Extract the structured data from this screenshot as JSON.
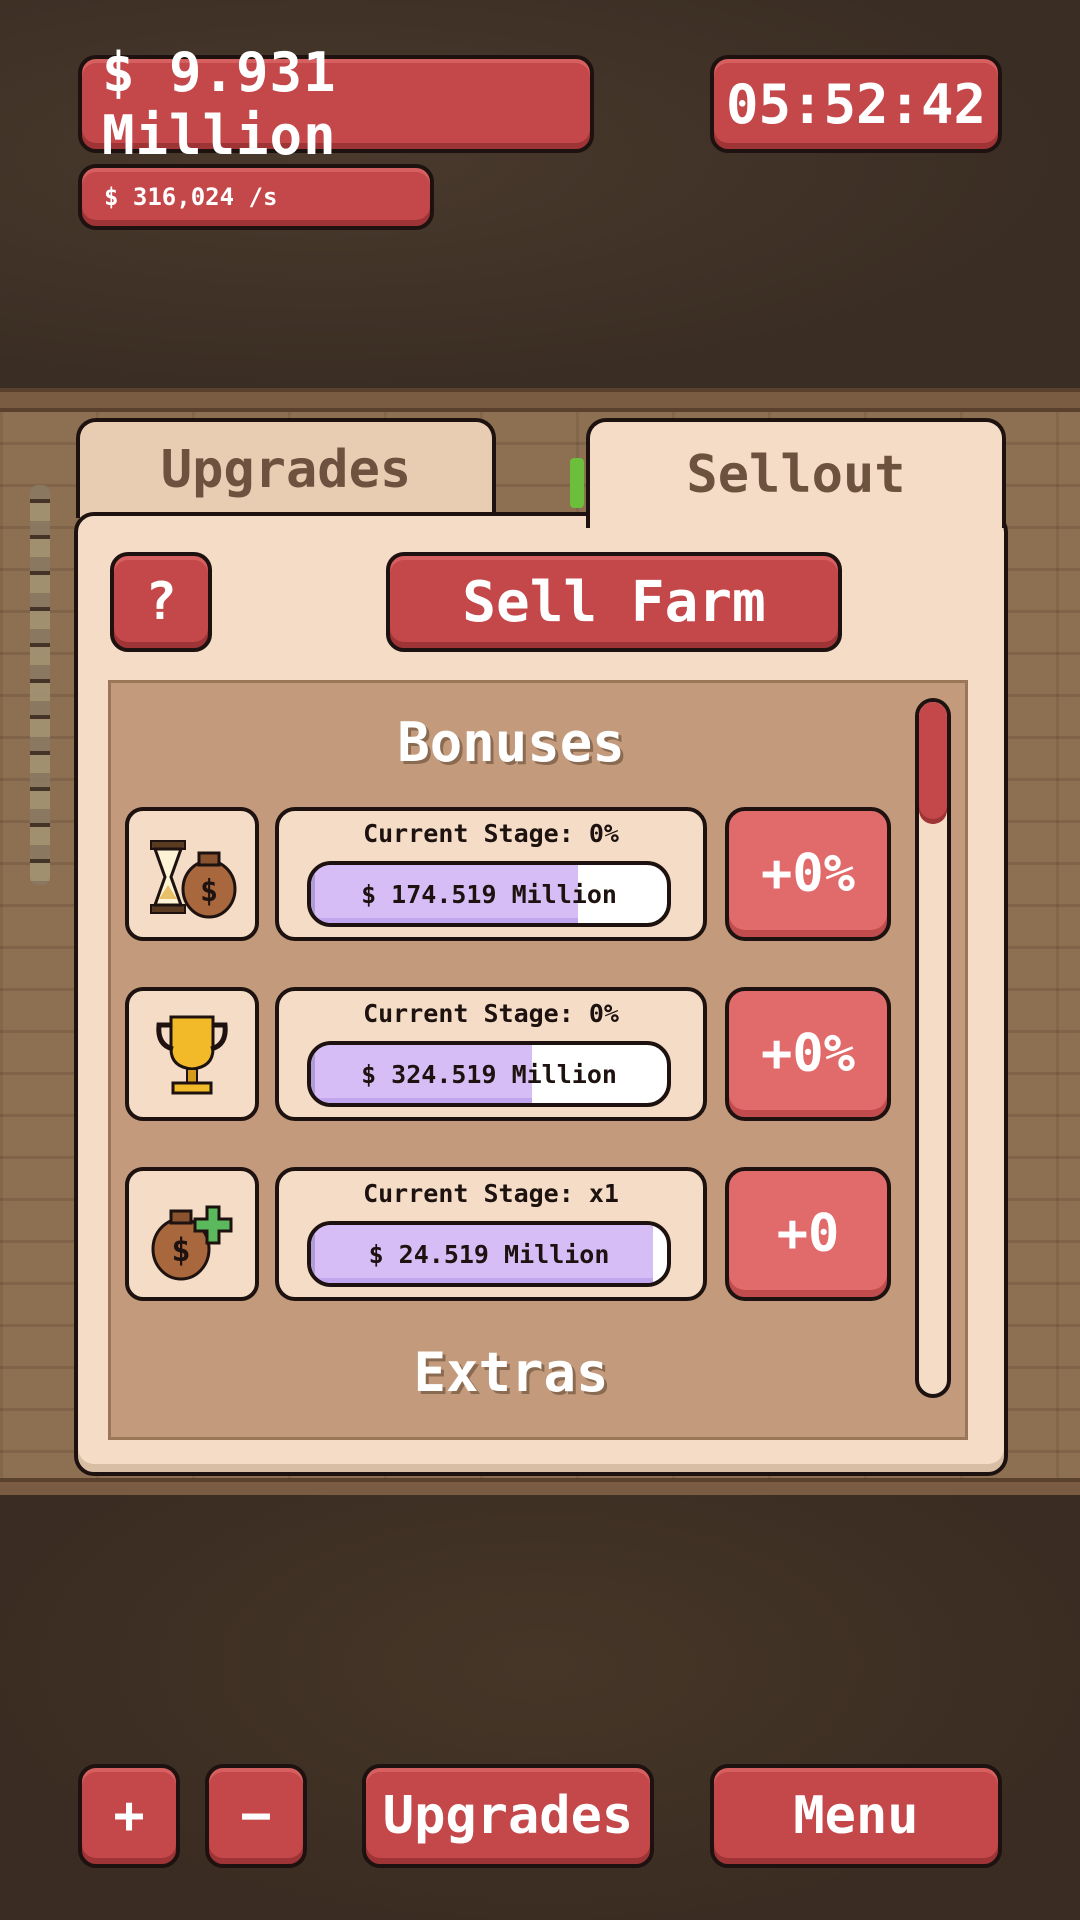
{
  "hud": {
    "money": "$ 9.931 Million",
    "rate": "$ 316,024 /s",
    "timer": "05:52:42"
  },
  "tabs": [
    {
      "label": "Upgrades",
      "active": false
    },
    {
      "label": "Sellout",
      "active": true
    }
  ],
  "sellout": {
    "help_label": "?",
    "sell_label": "Sell Farm",
    "bonuses_title": "Bonuses",
    "extras_title": "Extras",
    "bonuses": [
      {
        "icon": "hourglass-moneybag-icon",
        "stage": "Current Stage: 0%",
        "cost": "$ 174.519 Million",
        "progress": 0.75,
        "bonus": "+0%"
      },
      {
        "icon": "trophy-icon",
        "stage": "Current Stage: 0%",
        "cost": "$ 324.519 Million",
        "progress": 0.62,
        "bonus": "+0%"
      },
      {
        "icon": "moneybag-plus-icon",
        "stage": "Current Stage: x1",
        "cost": "$ 24.519 Million",
        "progress": 0.96,
        "bonus": "+0"
      }
    ]
  },
  "bottom_bar": {
    "plus": "+",
    "minus": "−",
    "upgrades": "Upgrades",
    "menu": "Menu"
  },
  "colors": {
    "button_red": "#c4474a",
    "bonus_red": "#e16a6a",
    "panel_cream": "#f4dcc6",
    "progress_purple": "#d7bdf6"
  }
}
